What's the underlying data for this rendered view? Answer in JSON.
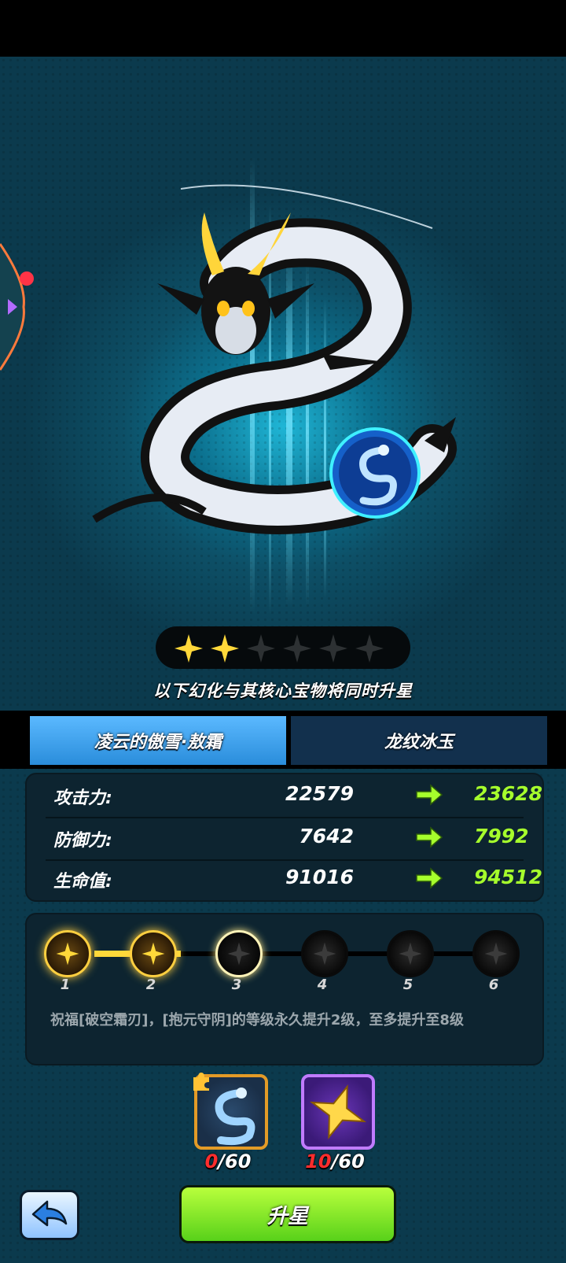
{
  "star_rating": {
    "current": 2,
    "max": 6
  },
  "notice": "以下幻化与其核心宝物将同时升星",
  "tabs": [
    {
      "label": "凌云的傲雪·敖霜",
      "selected": true
    },
    {
      "label": "龙纹冰玉",
      "selected": false
    }
  ],
  "stats": [
    {
      "name": "攻击力:",
      "old": "22579",
      "new": "23628"
    },
    {
      "name": "防御力:",
      "old": "7642",
      "new": "7992"
    },
    {
      "name": "生命值:",
      "old": "91016",
      "new": "94512"
    }
  ],
  "levels": {
    "nodes": [
      "1",
      "2",
      "3",
      "4",
      "5",
      "6"
    ],
    "reached": 2,
    "description": "祝福[破空霜刃]，[抱元守阴]的等级永久提升2级，至多提升至8级"
  },
  "materials": [
    {
      "icon": "ice-dragon-jade-icon",
      "current": "0",
      "required": "/60"
    },
    {
      "icon": "gold-star-icon",
      "current": "10",
      "required": "/60"
    }
  ],
  "buttons": {
    "upgrade_label": "升星"
  },
  "icons": {
    "back": "back-arrow-icon",
    "stat_arrow": "green-arrow-icon",
    "dragon": "white-dragon-illustration"
  },
  "colors": {
    "accent_green": "#a6ff2c",
    "tab_active": "#3a9ee8",
    "count_red": "#ff2d2d"
  }
}
